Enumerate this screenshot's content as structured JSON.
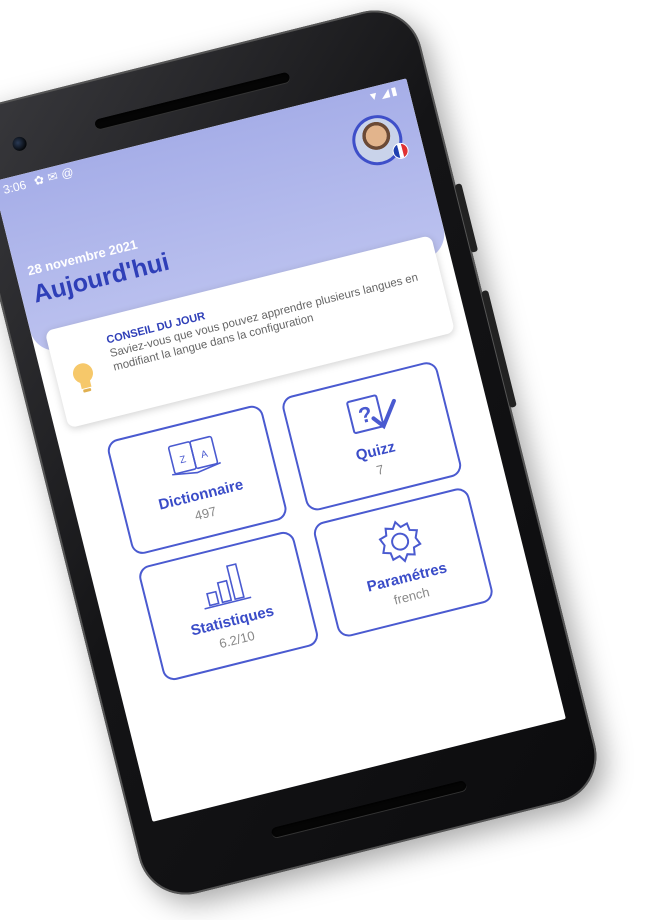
{
  "status_bar": {
    "time": "3:06",
    "left_icons": [
      "settings-icon",
      "sim-icon",
      "at-icon"
    ],
    "right_icons": [
      "wifi-icon",
      "signal-icon",
      "battery-icon"
    ]
  },
  "header": {
    "date": "28 novembre 2021",
    "title": "Aujourd'hui",
    "avatar_flag": "france-flag"
  },
  "tip": {
    "label": "CONSEIL DU JOUR",
    "text": "Saviez-vous que vous pouvez apprendre plusieurs langues en modifiant la langue dans la configuration",
    "icon": "lightbulb-icon"
  },
  "tiles": {
    "dictionary": {
      "label": "Dictionnaire",
      "value": "497",
      "icon": "dictionary-icon"
    },
    "quiz": {
      "label": "Quizz",
      "value": "7",
      "icon": "quiz-icon"
    },
    "stats": {
      "label": "Statistiques",
      "value": "6.2/10",
      "icon": "bar-chart-icon"
    },
    "settings": {
      "label": "Paramétres",
      "value": "french",
      "icon": "gear-icon"
    }
  },
  "colors": {
    "accent": "#3a4cc8",
    "header_bg": "#a6aee8",
    "tip_bulb": "#f6c86a",
    "phone_body": "#141416"
  }
}
